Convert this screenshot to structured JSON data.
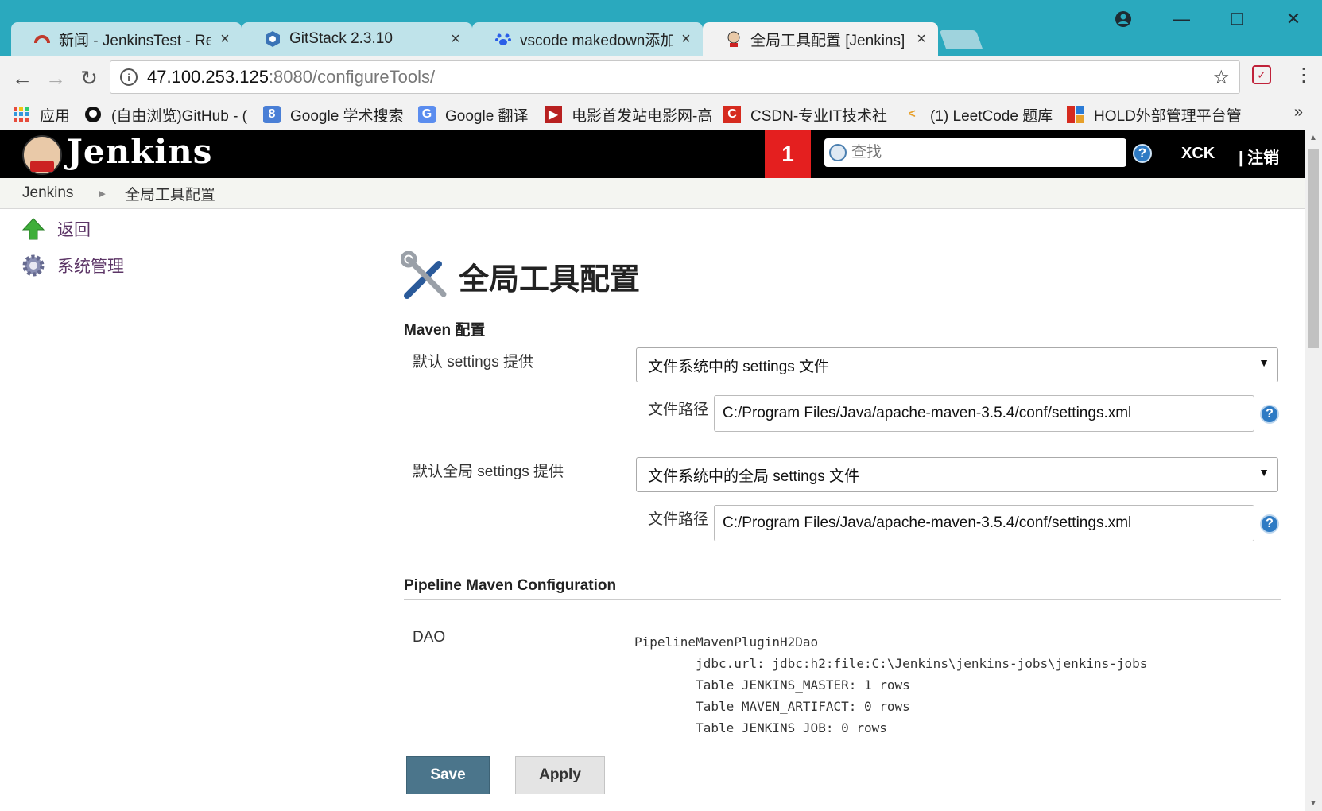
{
  "browser": {
    "tabs": [
      {
        "title": "新闻 - JenkinsTest - Re",
        "icon": "jenkins-dashboard-icon",
        "active": false
      },
      {
        "title": "GitStack 2.3.10",
        "icon": "gitstack-icon",
        "active": false
      },
      {
        "title": "vscode makedown添加",
        "icon": "baidu-paw-icon",
        "active": false
      },
      {
        "title": "全局工具配置 [Jenkins]",
        "icon": "jenkins-icon",
        "active": true
      }
    ],
    "tab_close": "×",
    "url_host": "47.100.253.125",
    "url_path": ":8080/configureTools/",
    "bookmarks": [
      {
        "label": "应用",
        "icon": "apps-grid-icon"
      },
      {
        "label": "(自由浏览)GitHub - (",
        "icon": "github-icon"
      },
      {
        "label": "Google 学术搜索",
        "icon": "google-scholar-icon"
      },
      {
        "label": "Google 翻译",
        "icon": "google-translate-icon"
      },
      {
        "label": "电影首发站电影网-高",
        "icon": "movie-site-icon"
      },
      {
        "label": "CSDN-专业IT技术社",
        "icon": "csdn-icon"
      },
      {
        "label": "(1) LeetCode 题库",
        "icon": "leetcode-icon"
      },
      {
        "label": "HOLD外部管理平台管",
        "icon": "hold-icon"
      }
    ]
  },
  "jenkins": {
    "title": "Jenkins",
    "notification_count": "1",
    "search_placeholder": "查找",
    "user": "XCK",
    "logout": "| 注销",
    "breadcrumb": [
      "Jenkins",
      "全局工具配置"
    ],
    "side_links": [
      {
        "label": "返回",
        "icon": "up-arrow-icon"
      },
      {
        "label": "系统管理",
        "icon": "gear-icon"
      }
    ],
    "page_title": "全局工具配置",
    "maven": {
      "section": "Maven 配置",
      "settings_label": "默认 settings 提供",
      "settings_value": "文件系统中的 settings 文件",
      "path_label": "文件路径",
      "settings_path": "C:/Program Files/Java/apache-maven-3.5.4/conf/settings.xml",
      "global_settings_label": "默认全局 settings 提供",
      "global_settings_value": "文件系统中的全局 settings 文件",
      "global_path_label": "文件路径",
      "global_settings_path": "C:/Program Files/Java/apache-maven-3.5.4/conf/settings.xml"
    },
    "pipeline": {
      "section": "Pipeline Maven Configuration",
      "dao_label": "DAO",
      "dao_lines": [
        "PipelineMavenPluginH2Dao",
        "        jdbc.url: jdbc:h2:file:C:\\Jenkins\\jenkins-jobs\\jenkins-jobs",
        "        Table JENKINS_MASTER: 1 rows",
        "        Table MAVEN_ARTIFACT: 0 rows",
        "        Table JENKINS_JOB: 0 rows"
      ]
    },
    "save_label": "Save",
    "apply_label": "Apply"
  },
  "colors": {
    "tabbar": "#2aa9be",
    "jenkins_header": "#000000",
    "badge": "#e41f1f",
    "save_button": "#4b758b",
    "link": "#5c3566"
  }
}
